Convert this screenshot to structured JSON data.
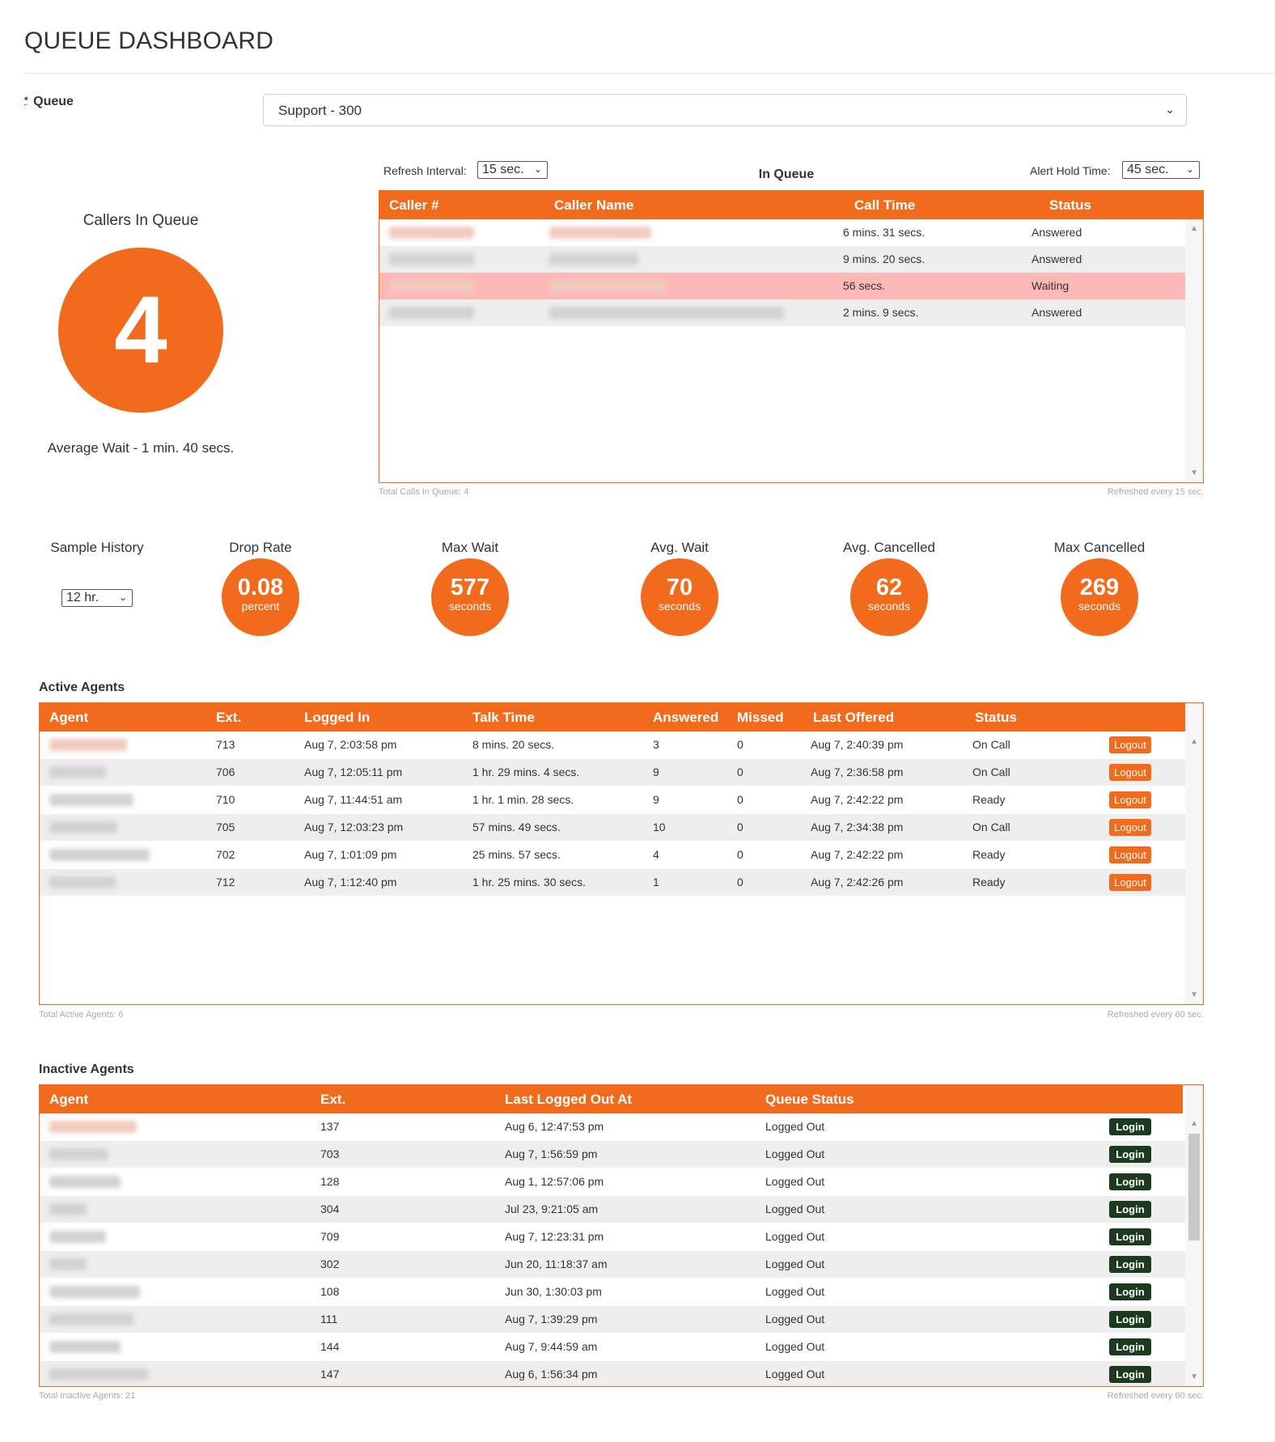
{
  "header": {
    "title": "QUEUE DASHBOARD"
  },
  "queue_selector": {
    "required_mark": "*",
    "label": "Queue",
    "value": "Support - 300"
  },
  "controls": {
    "refresh_interval_label": "Refresh Interval:",
    "refresh_interval_value": "15 sec.",
    "alert_hold_label": "Alert Hold Time:",
    "alert_hold_value": "45 sec."
  },
  "callers_panel": {
    "title": "Callers In Queue",
    "count": "4",
    "average_wait": "Average Wait - 1 min. 40 secs."
  },
  "in_queue": {
    "title": "In Queue",
    "columns": [
      "Caller #",
      "Caller Name",
      "Call Time",
      "Status"
    ],
    "rows": [
      {
        "call_time": "6 mins. 31 secs.",
        "status": "Answered"
      },
      {
        "call_time": "9 mins. 20 secs.",
        "status": "Answered"
      },
      {
        "call_time": "56 secs.",
        "status": "Waiting"
      },
      {
        "call_time": "2 mins. 9 secs.",
        "status": "Answered"
      }
    ],
    "footer_total": "Total Calls In Queue: 4",
    "footer_refresh": "Refreshed every 15 sec."
  },
  "stats": {
    "sample_history_label": "Sample History",
    "sample_history_value": "12 hr.",
    "items": [
      {
        "label": "Drop Rate",
        "value": "0.08",
        "unit": "percent"
      },
      {
        "label": "Max Wait",
        "value": "577",
        "unit": "seconds"
      },
      {
        "label": "Avg. Wait",
        "value": "70",
        "unit": "seconds"
      },
      {
        "label": "Avg. Cancelled",
        "value": "62",
        "unit": "seconds"
      },
      {
        "label": "Max Cancelled",
        "value": "269",
        "unit": "seconds"
      }
    ]
  },
  "active_agents": {
    "title": "Active Agents",
    "columns": [
      "Agent",
      "Ext.",
      "Logged In",
      "Talk Time",
      "Answered",
      "Missed",
      "Last Offered",
      "Status"
    ],
    "button_label": "Logout",
    "rows": [
      {
        "ext": "713",
        "logged_in": "Aug 7, 2:03:58 pm",
        "talk_time": "8 mins. 20 secs.",
        "answered": "3",
        "missed": "0",
        "last_offered": "Aug 7, 2:40:39 pm",
        "status": "On Call"
      },
      {
        "ext": "706",
        "logged_in": "Aug 7, 12:05:11 pm",
        "talk_time": "1 hr. 29 mins. 4 secs.",
        "answered": "9",
        "missed": "0",
        "last_offered": "Aug 7, 2:36:58 pm",
        "status": "On Call"
      },
      {
        "ext": "710",
        "logged_in": "Aug 7, 11:44:51 am",
        "talk_time": "1 hr. 1 min. 28 secs.",
        "answered": "9",
        "missed": "0",
        "last_offered": "Aug 7, 2:42:22 pm",
        "status": "Ready"
      },
      {
        "ext": "705",
        "logged_in": "Aug 7, 12:03:23 pm",
        "talk_time": "57 mins. 49 secs.",
        "answered": "10",
        "missed": "0",
        "last_offered": "Aug 7, 2:34:38 pm",
        "status": "On Call"
      },
      {
        "ext": "702",
        "logged_in": "Aug 7, 1:01:09 pm",
        "talk_time": "25 mins. 57 secs.",
        "answered": "4",
        "missed": "0",
        "last_offered": "Aug 7, 2:42:22 pm",
        "status": "Ready"
      },
      {
        "ext": "712",
        "logged_in": "Aug 7, 1:12:40 pm",
        "talk_time": "1 hr. 25 mins. 30 secs.",
        "answered": "1",
        "missed": "0",
        "last_offered": "Aug 7, 2:42:26 pm",
        "status": "Ready"
      }
    ],
    "footer_total": "Total Active Agents: 6",
    "footer_refresh": "Refreshed every 60 sec."
  },
  "inactive_agents": {
    "title": "Inactive Agents",
    "columns": [
      "Agent",
      "Ext.",
      "Last Logged Out At",
      "Queue Status"
    ],
    "button_label": "Login",
    "rows": [
      {
        "ext": "137",
        "last_logged_out": "Aug 6, 12:47:53 pm",
        "queue_status": "Logged Out"
      },
      {
        "ext": "703",
        "last_logged_out": "Aug 7, 1:56:59 pm",
        "queue_status": "Logged Out"
      },
      {
        "ext": "128",
        "last_logged_out": "Aug 1, 12:57:06 pm",
        "queue_status": "Logged Out"
      },
      {
        "ext": "304",
        "last_logged_out": "Jul 23, 9:21:05 am",
        "queue_status": "Logged Out"
      },
      {
        "ext": "709",
        "last_logged_out": "Aug 7, 12:23:31 pm",
        "queue_status": "Logged Out"
      },
      {
        "ext": "302",
        "last_logged_out": "Jun 20, 11:18:37 am",
        "queue_status": "Logged Out"
      },
      {
        "ext": "108",
        "last_logged_out": "Jun 30, 1:30:03 pm",
        "queue_status": "Logged Out"
      },
      {
        "ext": "111",
        "last_logged_out": "Aug 7, 1:39:29 pm",
        "queue_status": "Logged Out"
      },
      {
        "ext": "144",
        "last_logged_out": "Aug 7, 9:44:59 am",
        "queue_status": "Logged Out"
      },
      {
        "ext": "147",
        "last_logged_out": "Aug 6, 1:56:34 pm",
        "queue_status": "Logged Out"
      }
    ],
    "footer_total": "Total Inactive Agents: 21",
    "footer_refresh": "Refreshed every 60 sec."
  },
  "colors": {
    "accent": "#f26a1b",
    "login_button": "#1b3a1e",
    "waiting_row": "#ffb8b8",
    "alt_row": "#eeeeee"
  },
  "icons": {
    "dropdown": "chevron-down-icon",
    "scroll_up": "scroll-up-icon",
    "scroll_down": "scroll-down-icon"
  }
}
